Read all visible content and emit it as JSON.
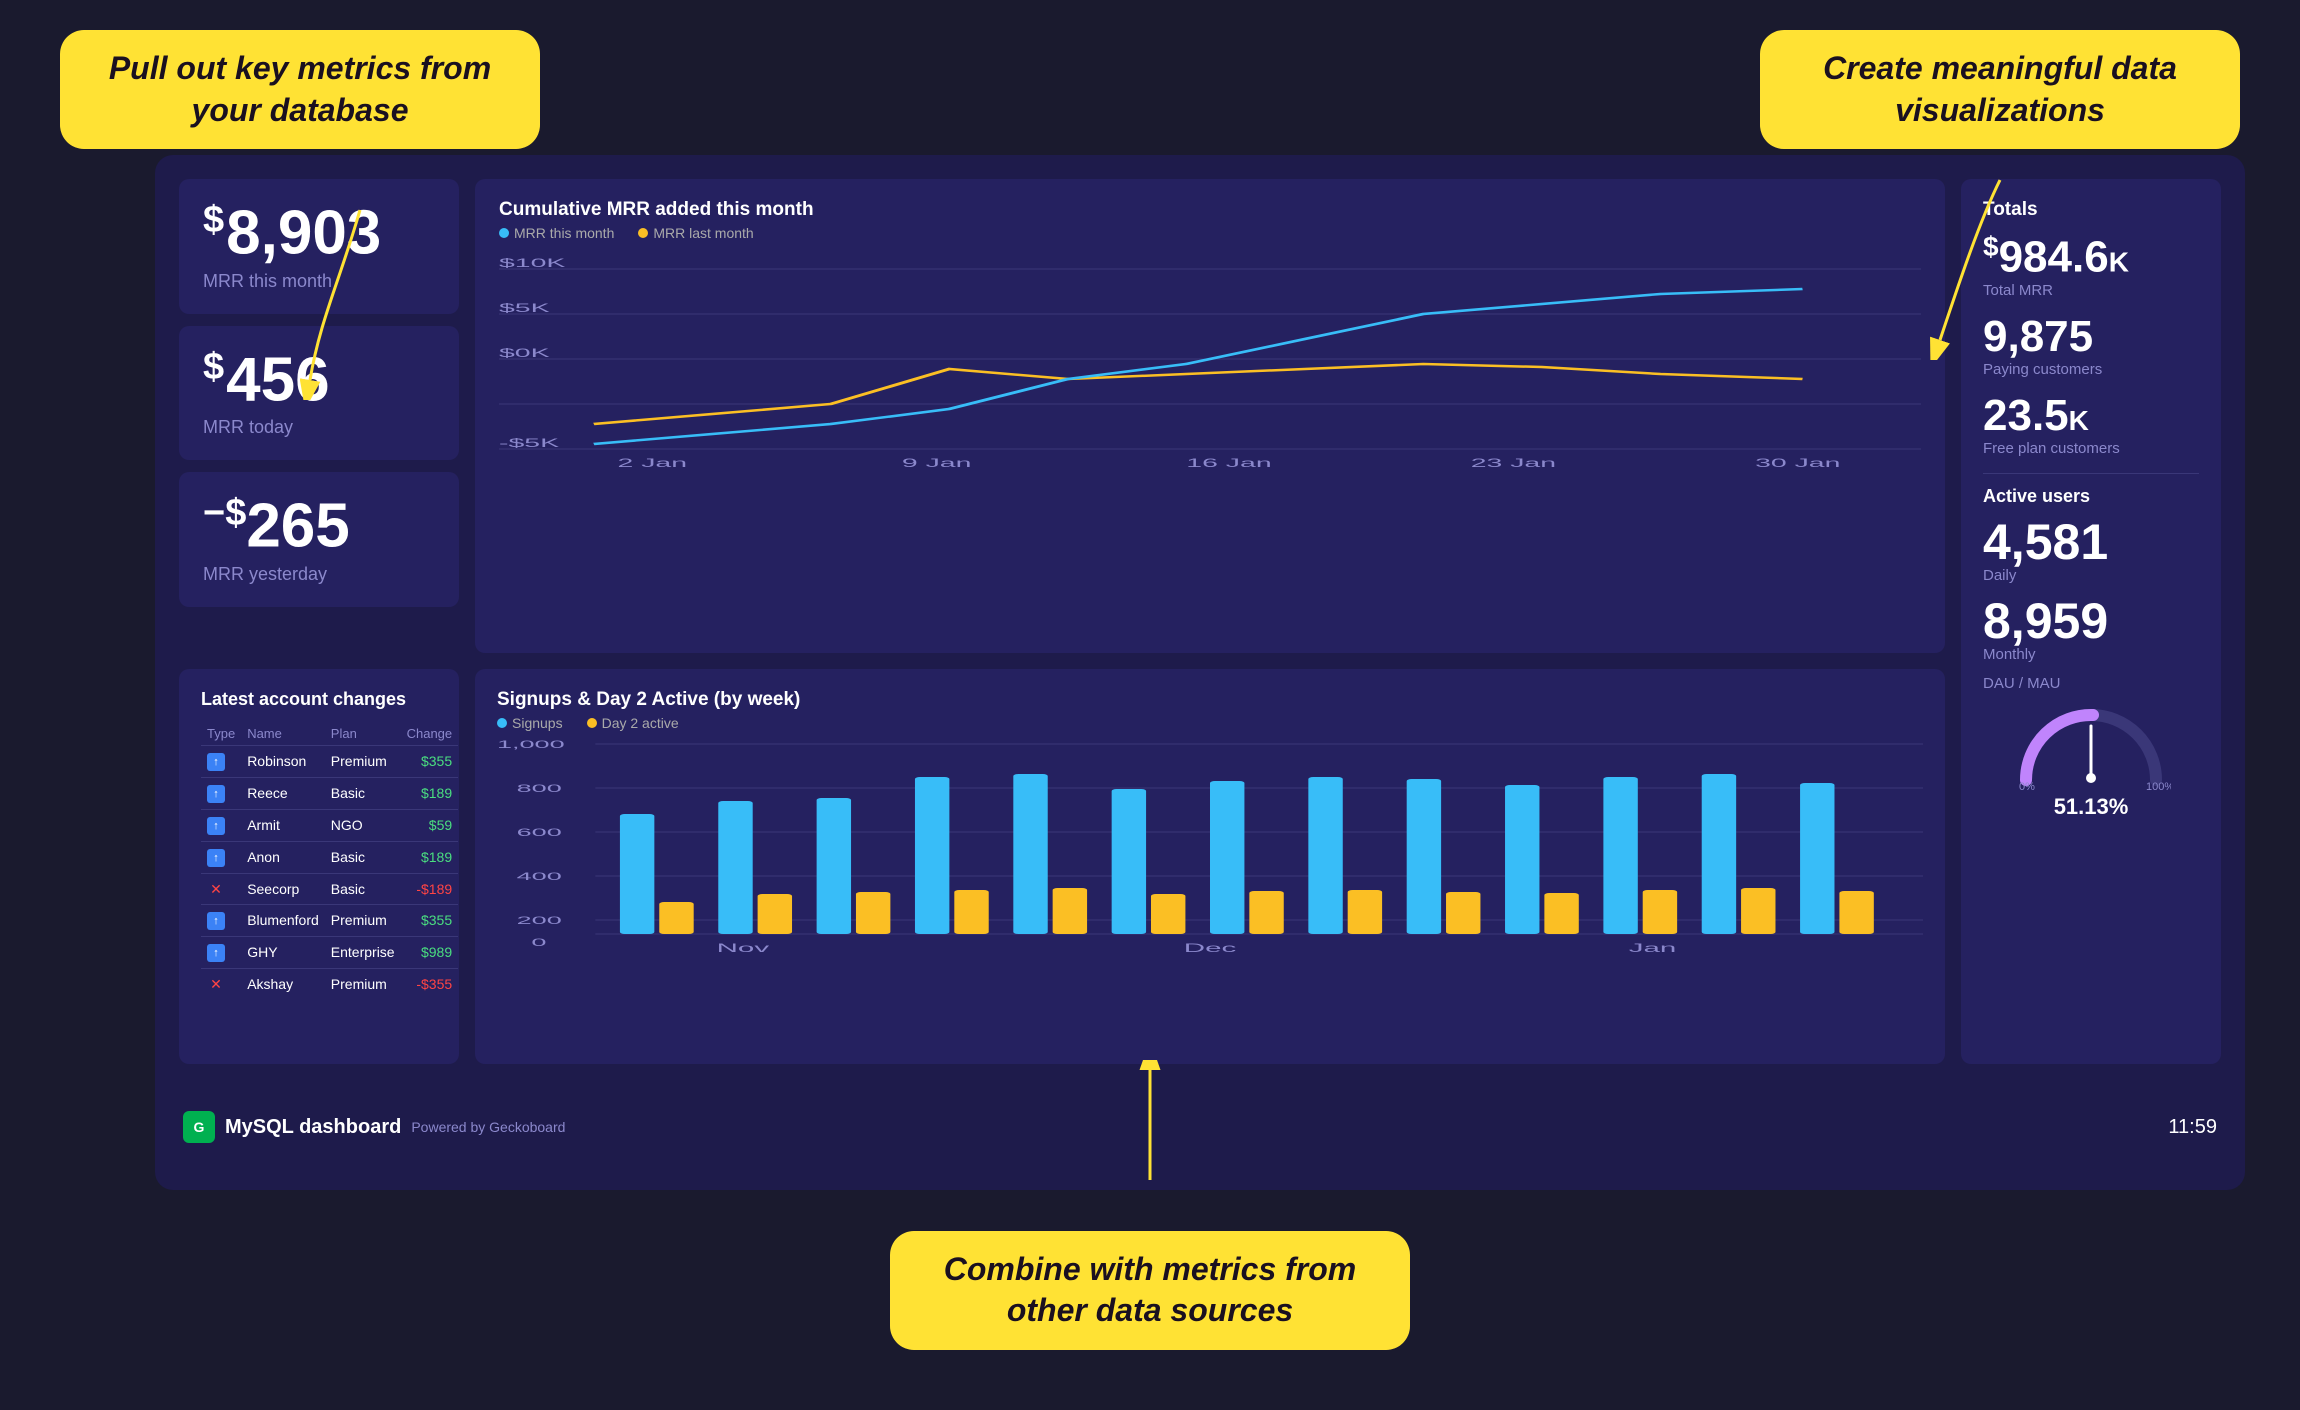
{
  "callouts": {
    "top_left": "Pull out key metrics from your database",
    "top_right": "Create meaningful data visualizations",
    "bottom": "Combine with metrics from other data sources"
  },
  "kpi": {
    "mrr_month_value": "8,903",
    "mrr_month_label": "MRR this month",
    "mrr_today_value": "456",
    "mrr_today_label": "MRR today",
    "mrr_yesterday_value": "265",
    "mrr_yesterday_label": "MRR yesterday"
  },
  "mrr_chart": {
    "title": "Cumulative MRR added this month",
    "legend_this_month": "MRR this month",
    "legend_last_month": "MRR last month",
    "y_labels": [
      "$10K",
      "$5K",
      "$0K",
      "-$5K"
    ],
    "x_labels": [
      "2 Jan",
      "9 Jan",
      "16 Jan",
      "23 Jan",
      "30 Jan"
    ]
  },
  "totals": {
    "section_title": "Totals",
    "total_mrr_value": "984.6",
    "total_mrr_suffix": "K",
    "total_mrr_label": "Total MRR",
    "paying_customers_value": "9,875",
    "paying_customers_label": "Paying customers",
    "free_plan_value": "23.5",
    "free_plan_suffix": "K",
    "free_plan_label": "Free plan customers",
    "active_users_title": "Active users",
    "daily_value": "4,581",
    "daily_label": "Daily",
    "monthly_value": "8,959",
    "monthly_label": "Monthly",
    "dau_mau_label": "DAU / MAU",
    "gauge_percent": "51.13",
    "gauge_label": "51.13%"
  },
  "table": {
    "title": "Latest account changes",
    "headers": [
      "Type",
      "Name",
      "Plan",
      "Change"
    ],
    "rows": [
      {
        "type": "up",
        "name": "Robinson",
        "plan": "Premium",
        "change": "$355",
        "positive": true
      },
      {
        "type": "up",
        "name": "Reece",
        "plan": "Basic",
        "change": "$189",
        "positive": true
      },
      {
        "type": "up",
        "name": "Armit",
        "plan": "NGO",
        "change": "$59",
        "positive": true
      },
      {
        "type": "up",
        "name": "Anon",
        "plan": "Basic",
        "change": "$189",
        "positive": true
      },
      {
        "type": "x",
        "name": "Seecorp",
        "plan": "Basic",
        "change": "-$189",
        "positive": false
      },
      {
        "type": "up",
        "name": "Blumenford",
        "plan": "Premium",
        "change": "$355",
        "positive": true
      },
      {
        "type": "up",
        "name": "GHY",
        "plan": "Enterprise",
        "change": "$989",
        "positive": true
      },
      {
        "type": "x",
        "name": "Akshay",
        "plan": "Premium",
        "change": "-$355",
        "positive": false
      }
    ]
  },
  "bar_chart": {
    "title": "Signups & Day 2 Active (by week)",
    "legend_signups": "Signups",
    "legend_day2": "Day 2 active",
    "y_labels": [
      "1,000",
      "800",
      "600",
      "400",
      "200",
      "0"
    ],
    "x_labels": [
      "Nov",
      "Dec",
      "Jan"
    ],
    "bars": [
      {
        "signups": 620,
        "day2": 160
      },
      {
        "signups": 680,
        "day2": 200
      },
      {
        "signups": 700,
        "day2": 210
      },
      {
        "signups": 820,
        "day2": 220
      },
      {
        "signups": 840,
        "day2": 230
      },
      {
        "signups": 760,
        "day2": 200
      },
      {
        "signups": 800,
        "day2": 215
      },
      {
        "signups": 830,
        "day2": 220
      },
      {
        "signups": 810,
        "day2": 210
      },
      {
        "signups": 780,
        "day2": 205
      },
      {
        "signups": 820,
        "day2": 220
      },
      {
        "signups": 840,
        "day2": 230
      },
      {
        "signups": 790,
        "day2": 215
      }
    ]
  },
  "footer": {
    "title": "MySQL dashboard",
    "powered": "Powered by Geckoboard",
    "time": "11:59"
  },
  "colors": {
    "mrr_this_month": "#38bdf8",
    "mrr_last_month": "#fbbf24",
    "signups": "#38bdf8",
    "day2_active": "#fbbf24",
    "dashboard_bg": "#1e1b4b",
    "card_bg": "#252160",
    "accent_yellow": "#FFE234"
  }
}
